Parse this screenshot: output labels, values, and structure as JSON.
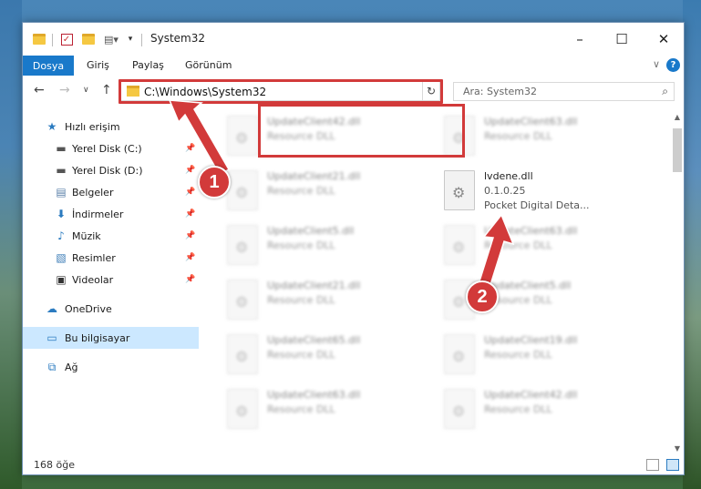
{
  "titlebar": {
    "title": "System32",
    "minimize": "–",
    "maximize": "☐",
    "close": "✕"
  },
  "ribbon": {
    "tabs": [
      "Dosya",
      "Giriş",
      "Paylaş",
      "Görünüm"
    ],
    "help": "?"
  },
  "nav": {
    "address": "C:\\Windows\\System32",
    "search_placeholder": "Ara: System32"
  },
  "sidebar": {
    "items": [
      {
        "label": "Hızlı erişim",
        "icon": "star-icon"
      },
      {
        "label": "Yerel Disk (C:)",
        "icon": "drive-icon"
      },
      {
        "label": "Yerel Disk (D:)",
        "icon": "drive-icon"
      },
      {
        "label": "Belgeler",
        "icon": "documents-icon"
      },
      {
        "label": "İndirmeler",
        "icon": "download-icon"
      },
      {
        "label": "Müzik",
        "icon": "music-icon"
      },
      {
        "label": "Resimler",
        "icon": "pictures-icon"
      },
      {
        "label": "Videolar",
        "icon": "video-icon"
      },
      {
        "label": "OneDrive",
        "icon": "cloud-icon"
      },
      {
        "label": "Bu bilgisayar",
        "icon": "computer-icon"
      },
      {
        "label": "Ağ",
        "icon": "network-icon"
      }
    ]
  },
  "files": {
    "left": [
      {
        "name": "UpdateClient42.dll",
        "desc": "Resource DLL"
      },
      {
        "name": "UpdateClient21.dll",
        "desc": "Resource DLL"
      },
      {
        "name": "UpdateClient5.dll",
        "desc": "Resource DLL"
      },
      {
        "name": "UpdateClient21.dll",
        "desc": "Resource DLL"
      },
      {
        "name": "UpdateClient65.dll",
        "desc": "Resource DLL"
      },
      {
        "name": "UpdateClient63.dll",
        "desc": "Resource DLL"
      }
    ],
    "right": [
      {
        "name": "UpdateClient63.dll",
        "desc": "Resource DLL"
      },
      {
        "name": "UpdateClient63.dll",
        "desc": "Resource DLL"
      },
      {
        "name": "UpdateClient5.dll",
        "desc": "Resource DLL"
      },
      {
        "name": "UpdateClient19.dll",
        "desc": "Resource DLL"
      },
      {
        "name": "UpdateClient42.dll",
        "desc": "Resource DLL"
      }
    ],
    "highlighted": {
      "name": "lvdene.dll",
      "version": "0.1.0.25",
      "desc": "Pocket Digital Deta..."
    }
  },
  "status": {
    "count": "168 öğe"
  },
  "markers": {
    "one": "1",
    "two": "2"
  },
  "colors": {
    "accent": "#1979ca",
    "highlight": "#d23a3a",
    "selected": "#cce8ff"
  }
}
